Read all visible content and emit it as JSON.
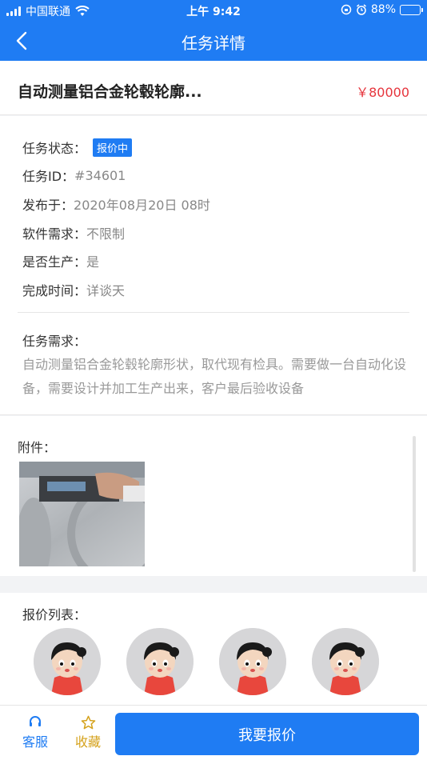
{
  "status_bar": {
    "carrier": "中国联通",
    "time": "上午 9:42",
    "battery_text": "88%",
    "battery_level": 0.88
  },
  "nav": {
    "title": "任务详情"
  },
  "task": {
    "title": "自动测量铝合金轮毂轮廓...",
    "price": "￥80000"
  },
  "info": {
    "status_label": "任务状态：",
    "status_value": "报价中",
    "id_label": "任务ID：",
    "id_value": "#34601",
    "published_label": "发布于：",
    "published_value": "2020年08月20日 08时",
    "software_label": "软件需求：",
    "software_value": "不限制",
    "production_label": "是否生产：",
    "production_value": "是",
    "deadline_label": "完成时间：",
    "deadline_value": "详谈天",
    "requirement_label": "任务需求：",
    "requirement_text": "自动测量铝合金轮毂轮廓形状，取代现有检具。需要做一台自动化设备，需要设计并加工生产出来，客户最后验收设备"
  },
  "attachment": {
    "label": "附件："
  },
  "quotes": {
    "label": "报价列表：",
    "count": 4
  },
  "bottom": {
    "service_label": "客服",
    "favorite_label": "收藏",
    "quote_button": "我要报价"
  },
  "colors": {
    "primary": "#1f7cf3",
    "price": "#e6353d",
    "favorite": "#d5a21c"
  }
}
